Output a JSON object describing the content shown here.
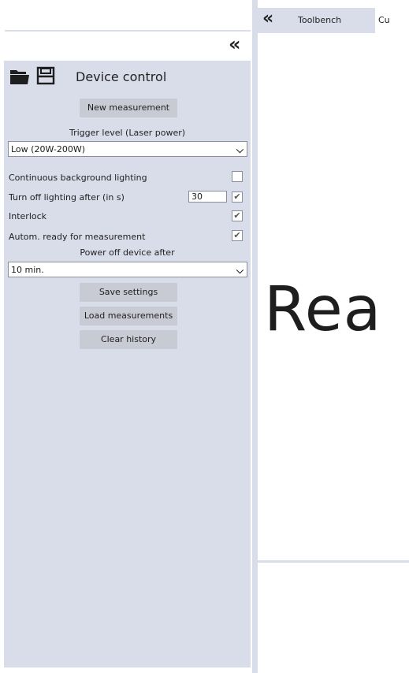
{
  "left": {
    "collapse_icon": "double-chevron-left-icon"
  },
  "panel": {
    "title": "Device control",
    "open_icon": "folder-open-icon",
    "save_icon": "save-icon",
    "new_measurement": "New measurement",
    "trigger_label": "Trigger level (Laser power)",
    "trigger_value": "Low (20W-200W)",
    "options": {
      "continuous_bg": {
        "label": "Continuous background lighting",
        "checked": false
      },
      "turn_off": {
        "label": "Turn off lighting after (in s)",
        "value": "30",
        "checked": true
      },
      "interlock": {
        "label": "Interlock",
        "checked": true
      },
      "autom_ready": {
        "label": "Autom. ready for measurement",
        "checked": true
      }
    },
    "power_off_label": "Power off device after",
    "power_off_value": "10 min.",
    "save_settings": "Save settings",
    "load_measurements": "Load measurements",
    "clear_history": "Clear history"
  },
  "right": {
    "collapse_icon": "double-chevron-left-icon",
    "tabs": [
      "Toolbench",
      "Cu"
    ],
    "big_text": "Rea"
  }
}
